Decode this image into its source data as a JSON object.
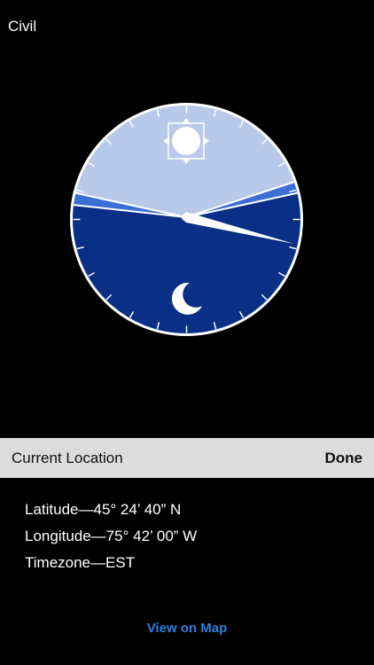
{
  "header": {
    "mode_label": "Civil"
  },
  "clock": {
    "icons": [
      "sun-icon",
      "moon-icon"
    ],
    "colors": {
      "day": "#b9c9ea",
      "twilight": "#3b6fd6",
      "night": "#0a2f86",
      "rim": "#ffffff"
    }
  },
  "location_bar": {
    "title": "Current Location",
    "done_label": "Done"
  },
  "details": {
    "latitude": "Latitude—45° 24’ 40” N",
    "longitude": "Longitude—75° 42’ 00” W",
    "timezone": "Timezone—EST"
  },
  "actions": {
    "view_map_label": "View on Map"
  }
}
